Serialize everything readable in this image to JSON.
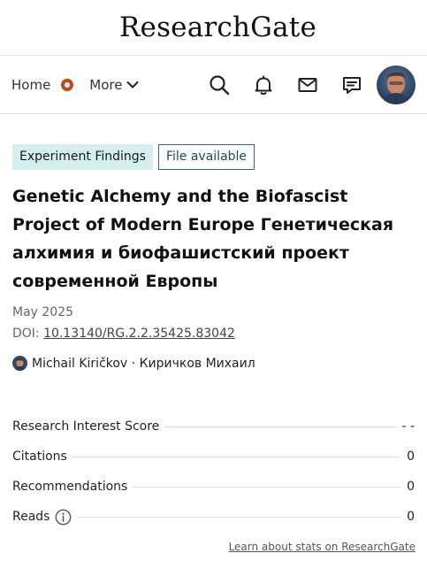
{
  "brand": {
    "logo_text": "ResearchGate"
  },
  "nav": {
    "home_label": "Home",
    "more_label": "More",
    "icons": [
      "search-icon",
      "bell-icon",
      "mail-icon",
      "chat-icon"
    ],
    "accent_color": "#c8461a"
  },
  "publication": {
    "type_badge": "Experiment Findings",
    "file_badge": "File available",
    "title": "Genetic Alchemy and the Biofascist Project of Modern Europe Генетическая алхимия и биофашистский проект современной Европы",
    "date": "May 2025",
    "doi_prefix": "DOI: ",
    "doi": "10.13140/RG.2.2.35425.83042",
    "author": "Michail Kiričkov · Киричков Михаил"
  },
  "stats": {
    "rows": [
      {
        "label": "Research Interest Score",
        "value": "- -"
      },
      {
        "label": "Citations",
        "value": "0"
      },
      {
        "label": "Recommendations",
        "value": "0"
      },
      {
        "label": "Reads",
        "value": "0"
      }
    ],
    "learn_link": "Learn about stats on ResearchGate"
  }
}
